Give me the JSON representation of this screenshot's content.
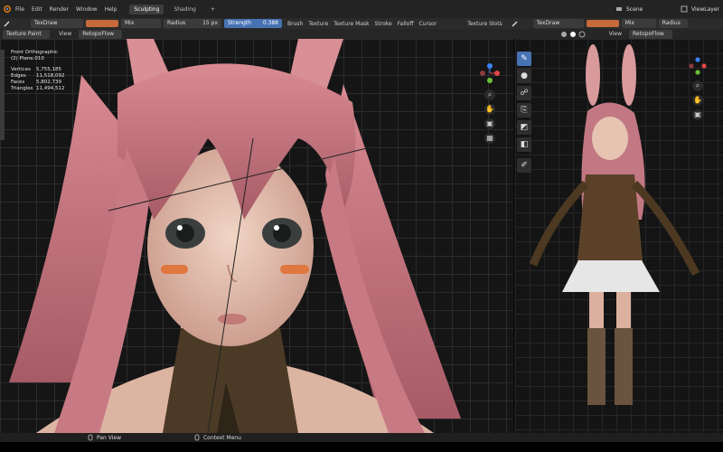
{
  "topbar": {
    "menus": [
      "File",
      "Edit",
      "Render",
      "Window",
      "Help"
    ],
    "tabs": [
      "Sculpting",
      "Shading",
      "+"
    ],
    "scene_label": "Scene",
    "view_layer_label": "ViewLayer"
  },
  "toolbar": {
    "brush_name": "TexDraw",
    "blend_mode": "Mix",
    "radius_label": "Radius",
    "radius_value": "15 px",
    "strength_label": "Strength",
    "strength_value": "0.388",
    "menus": [
      "Brush",
      "Texture",
      "Texture Mask",
      "Stroke",
      "Falloff",
      "Cursor"
    ],
    "texture_slots": "Texture Slots",
    "right_brush_name": "TexDraw",
    "right_blend_mode": "Mix",
    "right_radius_label": "Radius"
  },
  "header": {
    "mode": "Texture Paint",
    "view_menu": "View",
    "uv_map": "RetopoFlow",
    "right_view_menu": "View",
    "right_uv_map": "RetopoFlow"
  },
  "viewport_left": {
    "title": "Front Orthographic",
    "object": "(2) Plane.010",
    "stats": [
      {
        "label": "Vertices",
        "value": "5,755,185"
      },
      {
        "label": "Edges",
        "value": "11,518,092"
      },
      {
        "label": "Faces",
        "value": "5,802,739"
      },
      {
        "label": "Triangles",
        "value": "11,494,512"
      }
    ]
  },
  "statusbar": {
    "pan_view": "Pan View",
    "context_menu": "Context Menu"
  },
  "colors": {
    "accent": "#4772b3",
    "brush_color": "#c76a3b",
    "hair": "#c98088",
    "skin": "#e8c4b0"
  }
}
